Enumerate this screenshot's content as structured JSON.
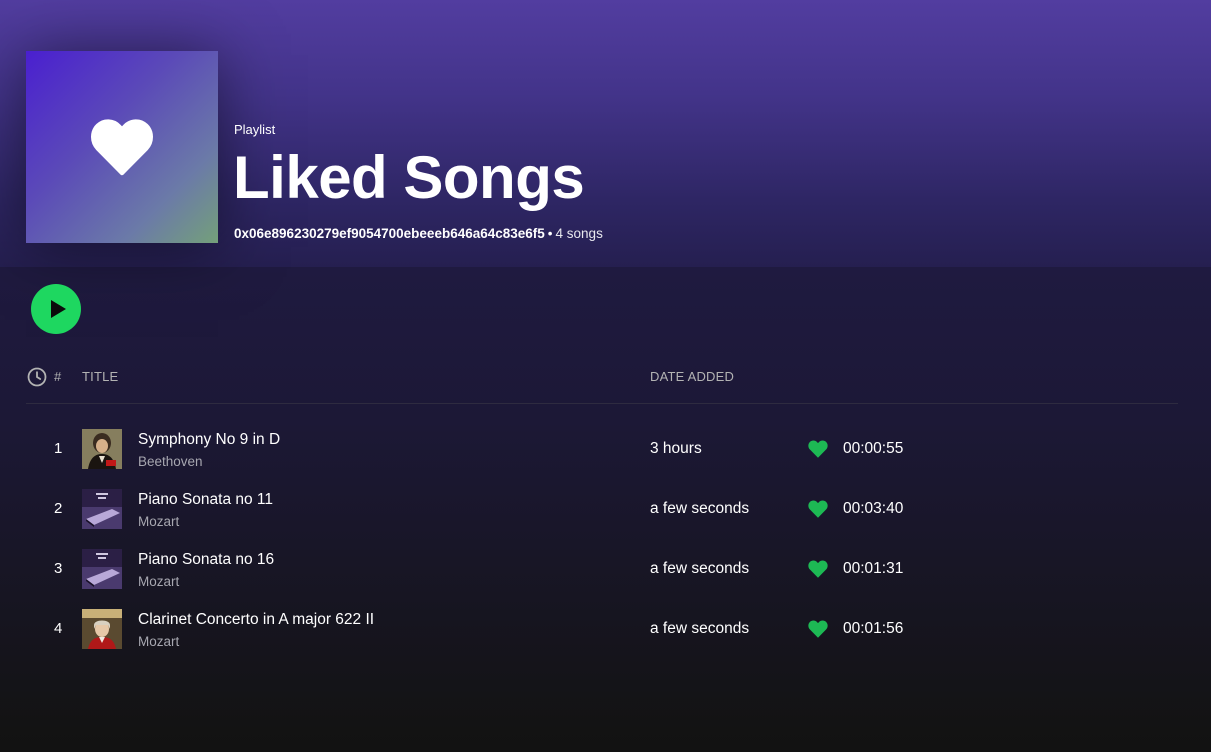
{
  "playlist": {
    "type_label": "Playlist",
    "title": "Liked Songs",
    "owner": "0x06e896230279ef9054700ebeeeb646a64c83e6f5",
    "separator": "•",
    "song_count": "4 songs",
    "cover_icon": "heart-icon"
  },
  "controls": {
    "play_icon": "play-icon",
    "accent_color": "#1ed760"
  },
  "table": {
    "headers": {
      "number": "#",
      "title": "TITLE",
      "date_added": "DATE ADDED",
      "duration_icon": "clock-icon"
    },
    "rows": [
      {
        "number": "1",
        "title": "Symphony No 9 in D",
        "artist": "Beethoven",
        "date_added": "3 hours",
        "liked": true,
        "duration": "00:00:55",
        "thumb": "beethoven-portrait"
      },
      {
        "number": "2",
        "title": "Piano Sonata no 11",
        "artist": "Mozart",
        "date_added": "a few seconds",
        "liked": true,
        "duration": "00:03:40",
        "thumb": "mozart-piano-cover"
      },
      {
        "number": "3",
        "title": "Piano Sonata no 16",
        "artist": "Mozart",
        "date_added": "a few seconds",
        "liked": true,
        "duration": "00:01:31",
        "thumb": "mozart-piano-cover"
      },
      {
        "number": "4",
        "title": "Clarinet Concerto in A major 622 II",
        "artist": "Mozart",
        "date_added": "a few seconds",
        "liked": true,
        "duration": "00:01:56",
        "thumb": "mozart-portrait"
      }
    ]
  }
}
